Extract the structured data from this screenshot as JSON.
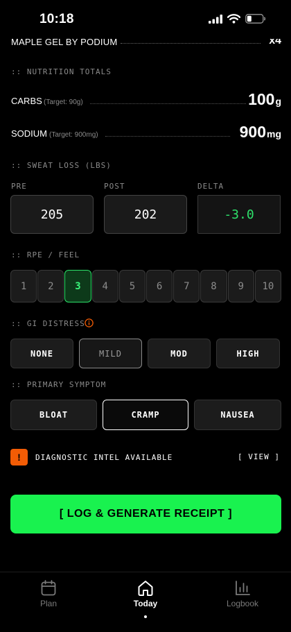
{
  "status_bar": {
    "time": "10:18"
  },
  "fuel_row": {
    "label": "MAPLE GEL BY PODIUM",
    "qty": "x4"
  },
  "nutrition": {
    "section_label": ":: NUTRITION TOTALS",
    "carbs": {
      "name": "CARBS",
      "target": "(Target: 90g)",
      "value": "100",
      "unit": "g"
    },
    "sodium": {
      "name": "SODIUM",
      "target": "(Target: 900mg)",
      "value": "900",
      "unit": "mg"
    }
  },
  "sweat_loss": {
    "section_label": ":: SWEAT LOSS (LBS)",
    "pre": {
      "label": "PRE",
      "value": "205"
    },
    "post": {
      "label": "POST",
      "value": "202"
    },
    "delta": {
      "label": "DELTA",
      "value": "-3.0"
    },
    "delta_color": "#2ee26b"
  },
  "rpe": {
    "section_label": ":: RPE / FEEL",
    "options": [
      "1",
      "2",
      "3",
      "4",
      "5",
      "6",
      "7",
      "8",
      "9",
      "10"
    ],
    "selected": "3"
  },
  "gi_distress": {
    "section_label": ":: GI DISTRESS",
    "info_icon": "info-icon",
    "options": [
      "NONE",
      "MILD",
      "MOD",
      "HIGH"
    ],
    "selected": "MILD"
  },
  "primary_symptom": {
    "section_label": ":: PRIMARY SYMPTOM",
    "options": [
      "BLOAT",
      "CRAMP",
      "NAUSEA"
    ],
    "selected": "CRAMP"
  },
  "alert": {
    "badge": "!",
    "text": "DIAGNOSTIC INTEL AVAILABLE",
    "action": "[ VIEW ]",
    "badge_color": "#f25c05"
  },
  "cta": {
    "label": "[ LOG & GENERATE RECEIPT ]",
    "color": "#19f24f"
  },
  "tabbar": {
    "tabs": [
      {
        "label": "Plan",
        "icon": "calendar-icon"
      },
      {
        "label": "Today",
        "icon": "home-icon",
        "active": true
      },
      {
        "label": "Logbook",
        "icon": "bar-chart-icon"
      }
    ]
  }
}
